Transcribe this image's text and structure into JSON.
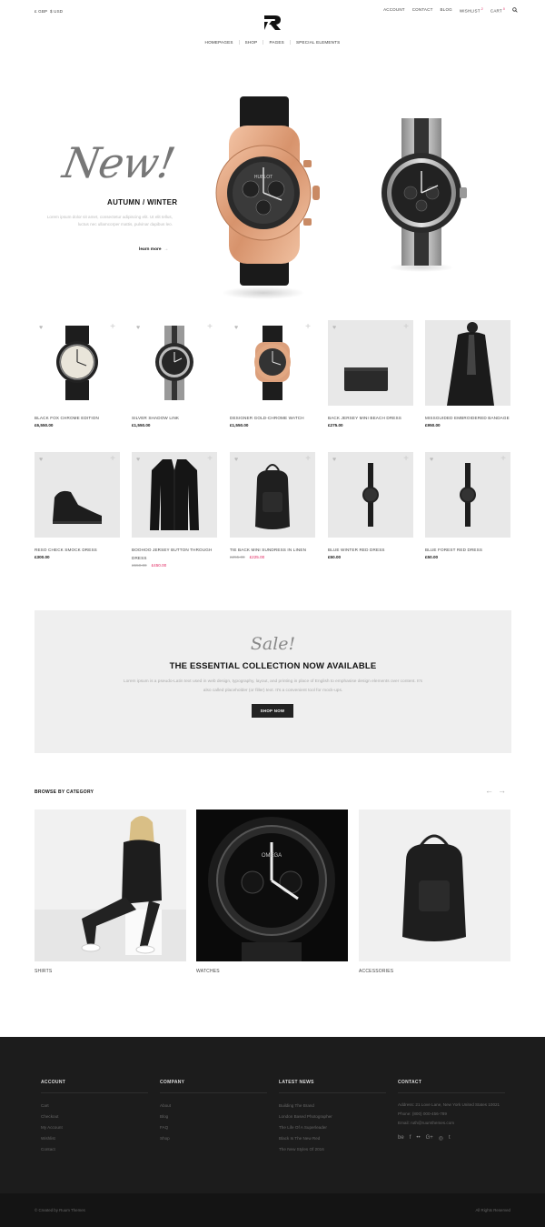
{
  "topbar": {
    "currency_gbp": "£ GBP",
    "currency_usd": "$ USD",
    "links": {
      "account": "ACCOUNT",
      "contact": "CONTACT",
      "blog": "BLOG",
      "wishlist": "WISHLIST",
      "wishlist_count": "2",
      "cart": "CART",
      "cart_count": "0"
    }
  },
  "nav": {
    "items": [
      "HOMEPAGES",
      "SHOP",
      "PAGES",
      "SPECIAL ELEMENTS"
    ]
  },
  "hero": {
    "script": "New!",
    "season": "AUTUMN / WINTER",
    "text": "Lorem ipsum dolor sit amet, consectetur adipiscing elit. Ut elit tellus, luctus nec ullamcorper mattis, pulvinar dapibus leo.",
    "link": "learn more",
    "link_arrow": "→",
    "watch_brand": "HUBLOT"
  },
  "products_row1": [
    {
      "name": "BLACK FOX CHROME EDITION",
      "price": "£6,550.00"
    },
    {
      "name": "SILVER SHADOW LINK",
      "price": "£1,550.00"
    },
    {
      "name": "DESIGNER GOLD-CHROME WATCH",
      "price": "£1,550.00"
    },
    {
      "name": "BACK JERSEY MINI BEACH DRESS",
      "price": "£275.00"
    },
    {
      "name": "MISSGUIDED EMBROIDERED BANDAGE",
      "price": "£950.00"
    }
  ],
  "products_row2": [
    {
      "name": "RESO CHECK SMOCK DRESS",
      "price": "£300.00"
    },
    {
      "name": "BOOHOO JERSEY BUTTON THROUGH DRESS",
      "old_price": "£550.00",
      "price": "£450.00"
    },
    {
      "name": "TIE BACK MINI SUNDRESS IN LINEN",
      "old_price": "£255.00",
      "price": "£225.00"
    },
    {
      "name": "BLUE WINTER RED DRESS",
      "price": "£50.00"
    },
    {
      "name": "BLUE FOREST RED DRESS",
      "price": "£50.00"
    }
  ],
  "sale": {
    "script": "Sale!",
    "title": "THE ESSENTIAL COLLECTION NOW AVAILABLE",
    "text": "Lorem ipsum is a pseudo-Latin text used in web design, typography, layout, and printing in place of English to emphasise design elements over content. It's also called placeholder (or filler) text. It's a convenient tool for mock-ups.",
    "button": "SHOP NOW"
  },
  "category": {
    "title": "BROWSE BY CATEGORY",
    "prev": "←",
    "next": "→",
    "items": [
      "SHIRTS",
      "WATCHES",
      "ACCESSORIES"
    ],
    "omega_label": "OMEGA"
  },
  "footer": {
    "account": {
      "title": "ACCOUNT",
      "links": [
        "Cart",
        "Checkout",
        "My Account",
        "Wishlist",
        "Contact"
      ]
    },
    "company": {
      "title": "COMPANY",
      "links": [
        "About",
        "Blog",
        "FAQ",
        "Shop"
      ]
    },
    "news": {
      "title": "LATEST NEWS",
      "links": [
        "Building The Brand",
        "London Based Photographer",
        "The Life Of A Superleader",
        "Black Is The New Red",
        "The New Styles Of 2016"
      ]
    },
    "contact": {
      "title": "CONTACT",
      "address": "Address: 21 Love Lane, New York United States 10021",
      "phone": "Phone: (800) 000-456-789",
      "email": "Email: ruth@ruumthemes.com",
      "socials": [
        "be",
        "f",
        "••",
        "G+",
        "◎",
        "t"
      ]
    },
    "copyright": "© Created by Ruum Themes",
    "rights": "All Rights Reserved"
  },
  "colors": {
    "accent": "#e0245e",
    "footer": "#1c1c1c",
    "banner": "#efefef"
  }
}
